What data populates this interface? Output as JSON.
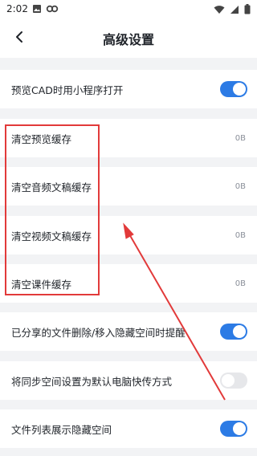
{
  "status_bar": {
    "time": "2:02",
    "left_icons": [
      "gallery-icon",
      "link-icon"
    ],
    "right_icons": [
      "wifi-icon",
      "signal-icon",
      "battery-icon"
    ]
  },
  "header": {
    "back_icon": "chevron-left-icon",
    "title": "高级设置"
  },
  "settings": [
    {
      "label": "预览CAD时用小程序打开",
      "control": "toggle",
      "on": true
    },
    {
      "label": "清空预览缓存",
      "value": "0B"
    },
    {
      "label": "清空音频文稿缓存",
      "value": "0B"
    },
    {
      "label": "清空视频文稿缓存",
      "value": "0B"
    },
    {
      "label": "清空课件缓存",
      "value": "0B"
    },
    {
      "label": "已分享的文件删除/移入隐藏空间时提醒",
      "control": "toggle",
      "on": true
    },
    {
      "label": "将同步空间设置为默认电脑快传方式",
      "control": "toggle",
      "on": false
    },
    {
      "label": "文件列表展示隐藏空间",
      "control": "toggle",
      "on": true
    }
  ],
  "colors": {
    "accent": "#2c7be5",
    "annotation": "#e23a3a",
    "background": "#f2f3f5"
  }
}
